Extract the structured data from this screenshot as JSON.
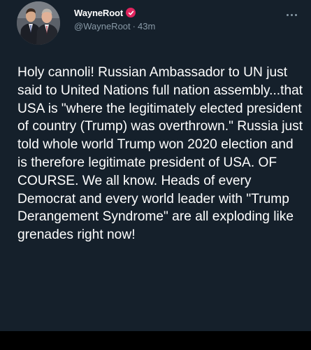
{
  "author": {
    "display_name": "WayneRoot",
    "handle": "@WayneRoot",
    "separator": "·",
    "time_ago": "43m",
    "verified_color": "#e0245e",
    "avatar_icon": "two-men-in-suits-photo"
  },
  "tweet": {
    "text": "Holy cannoli! Russian Ambassador to UN just said to United Nations full nation assembly...that USA is \"where the legitimately elected president of country (Trump) was overthrown.\" Russia just told whole world Trump won 2020 election and is therefore legitimate president of USA. OF COURSE. We all know. Heads of every Democrat and every world leader with \"Trump Derangement Syndrome\" are all exploding like grenades right now!"
  },
  "theme": {
    "background": "#15202b",
    "text": "#ffffff",
    "secondary_text": "#8899a6"
  },
  "icons": {
    "more": "more-options-icon",
    "verified": "verified-badge-icon"
  }
}
